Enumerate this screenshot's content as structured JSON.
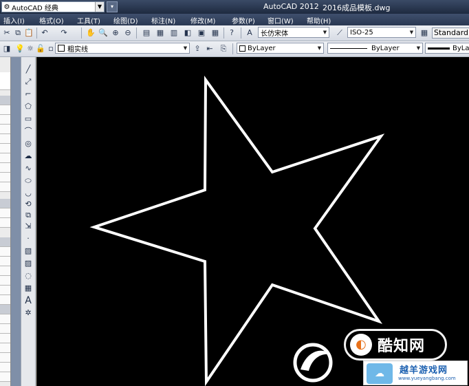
{
  "titlebar": {
    "workspace": "AutoCAD 经典",
    "app_title": "AutoCAD 2012",
    "file_name": "2016成品模板.dwg"
  },
  "menu": [
    "插入(I)",
    "格式(O)",
    "工具(T)",
    "绘图(D)",
    "标注(N)",
    "修改(M)",
    "参数(P)",
    "窗口(W)",
    "帮助(H)"
  ],
  "toolbar": {
    "text_style": "长仿宋体",
    "dim_style": "ISO-25",
    "table_style": "Standard"
  },
  "layers": {
    "current_layer": "粗实线",
    "color": "ByLayer",
    "linetype": "ByLayer",
    "lineweight": "ByLayer"
  },
  "drawing": {
    "shape": "five-pointed star",
    "stroke_color": "#ffffff",
    "background": "#000000"
  },
  "watermark": {
    "brand": "酷知网",
    "site_name": "越羊游戏网",
    "site_url": "www.yueyangbang.com"
  }
}
